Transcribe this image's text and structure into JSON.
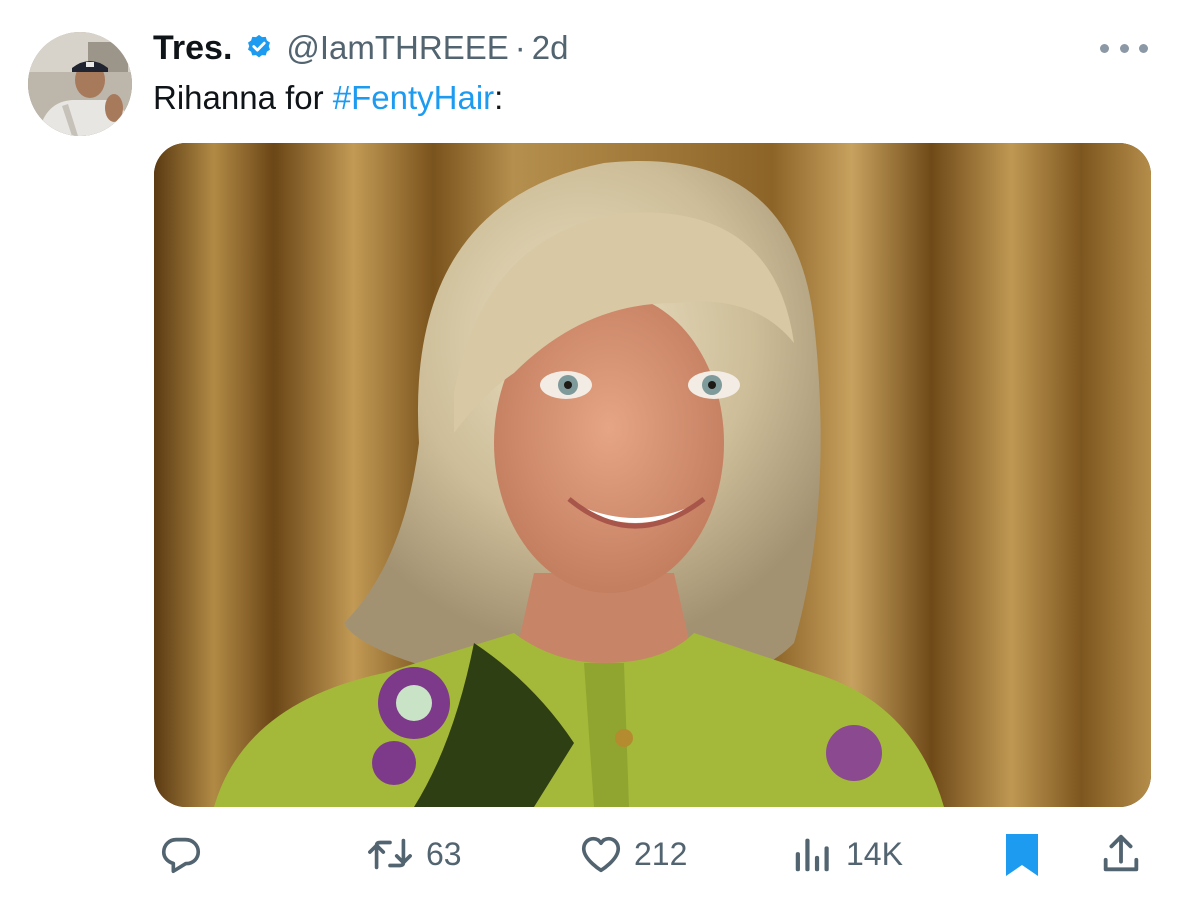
{
  "author": {
    "display_name": "Tres.",
    "handle": "@IamTHREEE",
    "separator": "·",
    "time": "2d"
  },
  "icons": {
    "verified": "verified-badge-icon",
    "more": "more-options-icon",
    "reply": "reply-icon",
    "retweet": "retweet-icon",
    "like": "heart-icon",
    "views": "analytics-icon",
    "bookmark": "bookmark-icon",
    "share": "share-icon"
  },
  "tweet": {
    "text_before": "Rihanna for ",
    "hashtag": "#FentyHair",
    "text_after": ":"
  },
  "metrics": {
    "retweets": "63",
    "likes": "212",
    "views": "14K"
  },
  "colors": {
    "accent": "#1d9bf0",
    "secondary_text": "#536471",
    "bookmark_active": "#1d9bf0"
  }
}
